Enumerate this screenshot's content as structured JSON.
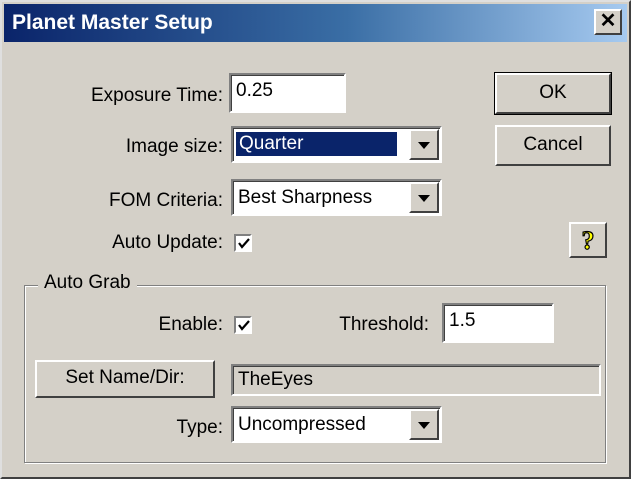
{
  "window": {
    "title": "Planet Master Setup",
    "close_glyph": "✕"
  },
  "fields": {
    "exposure_label": "Exposure Time:",
    "exposure_value": "0.25",
    "image_size_label": "Image size:",
    "image_size_value": "Quarter",
    "fom_label": "FOM Criteria:",
    "fom_value": "Best Sharpness",
    "auto_update_label": "Auto Update:",
    "auto_update_checked": true
  },
  "buttons": {
    "ok": "OK",
    "cancel": "Cancel",
    "help_icon": "question-mark-icon"
  },
  "auto_grab": {
    "title": "Auto Grab",
    "enable_label": "Enable:",
    "enable_checked": true,
    "threshold_label": "Threshold:",
    "threshold_value": "1.5",
    "set_name_button": "Set Name/Dir:",
    "name_value": "TheEyes",
    "type_label": "Type:",
    "type_value": "Uncompressed"
  },
  "colors": {
    "titlebar_start": "#0a246a",
    "titlebar_end": "#a6caf0",
    "face": "#d4d0c8",
    "selection": "#0a246a"
  }
}
